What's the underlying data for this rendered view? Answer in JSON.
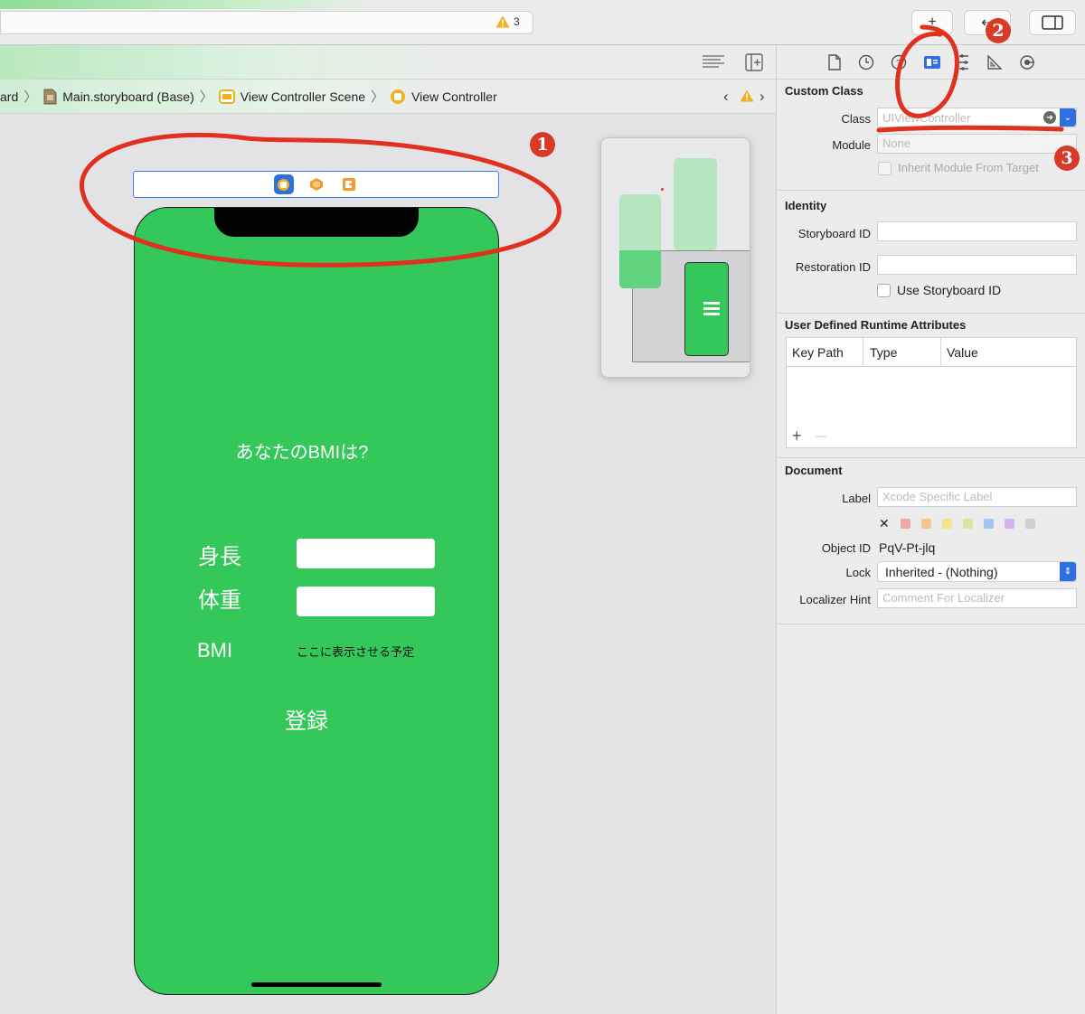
{
  "toolbar": {
    "warning_count": "3",
    "add_label": "+",
    "back_label": "⇠"
  },
  "breadcrumb": [
    {
      "label": "ard",
      "icon": "storyboard-icon"
    },
    {
      "label": "Main.storyboard (Base)",
      "icon": "storyboard-file-icon"
    },
    {
      "label": "View Controller Scene",
      "icon": "scene-icon"
    },
    {
      "label": "View Controller",
      "icon": "view-controller-icon"
    }
  ],
  "phone": {
    "question": "あなたのBMIは?",
    "height_label": "身長",
    "weight_label": "体重",
    "bmi_label": "BMI",
    "bmi_value": "ここに表示させる予定",
    "register_label": "登録"
  },
  "inspector": {
    "custom_class": {
      "title": "Custom Class",
      "class_label": "Class",
      "class_placeholder": "UIViewController",
      "module_label": "Module",
      "module_placeholder": "None",
      "inherit_label": "Inherit Module From Target"
    },
    "identity": {
      "title": "Identity",
      "storyboard_id_label": "Storyboard ID",
      "restoration_id_label": "Restoration ID",
      "use_storyboard_id_label": "Use Storyboard ID"
    },
    "runtime_attrs": {
      "title": "User Defined Runtime Attributes",
      "columns": [
        "Key Path",
        "Type",
        "Value"
      ],
      "add_label": "+",
      "remove_label": "—"
    },
    "document": {
      "title": "Document",
      "label_label": "Label",
      "label_placeholder": "Xcode Specific Label",
      "object_id_label": "Object ID",
      "object_id_value": "PqV-Pt-jlq",
      "lock_label": "Lock",
      "lock_value": "Inherited - (Nothing)",
      "localizer_label": "Localizer Hint",
      "localizer_placeholder": "Comment For Localizer",
      "swatch_colors": [
        "#f1a8a4",
        "#f5c48f",
        "#f4e48e",
        "#d7e89a",
        "#9fc6f2",
        "#d6b3ee",
        "#cfcfcf"
      ]
    }
  },
  "annotations": {
    "one": "1",
    "two": "2",
    "three": "3"
  },
  "colors": {
    "view_background": "#34c759",
    "annotation_red": "#e0301e",
    "accent_blue": "#2f6fe0"
  }
}
